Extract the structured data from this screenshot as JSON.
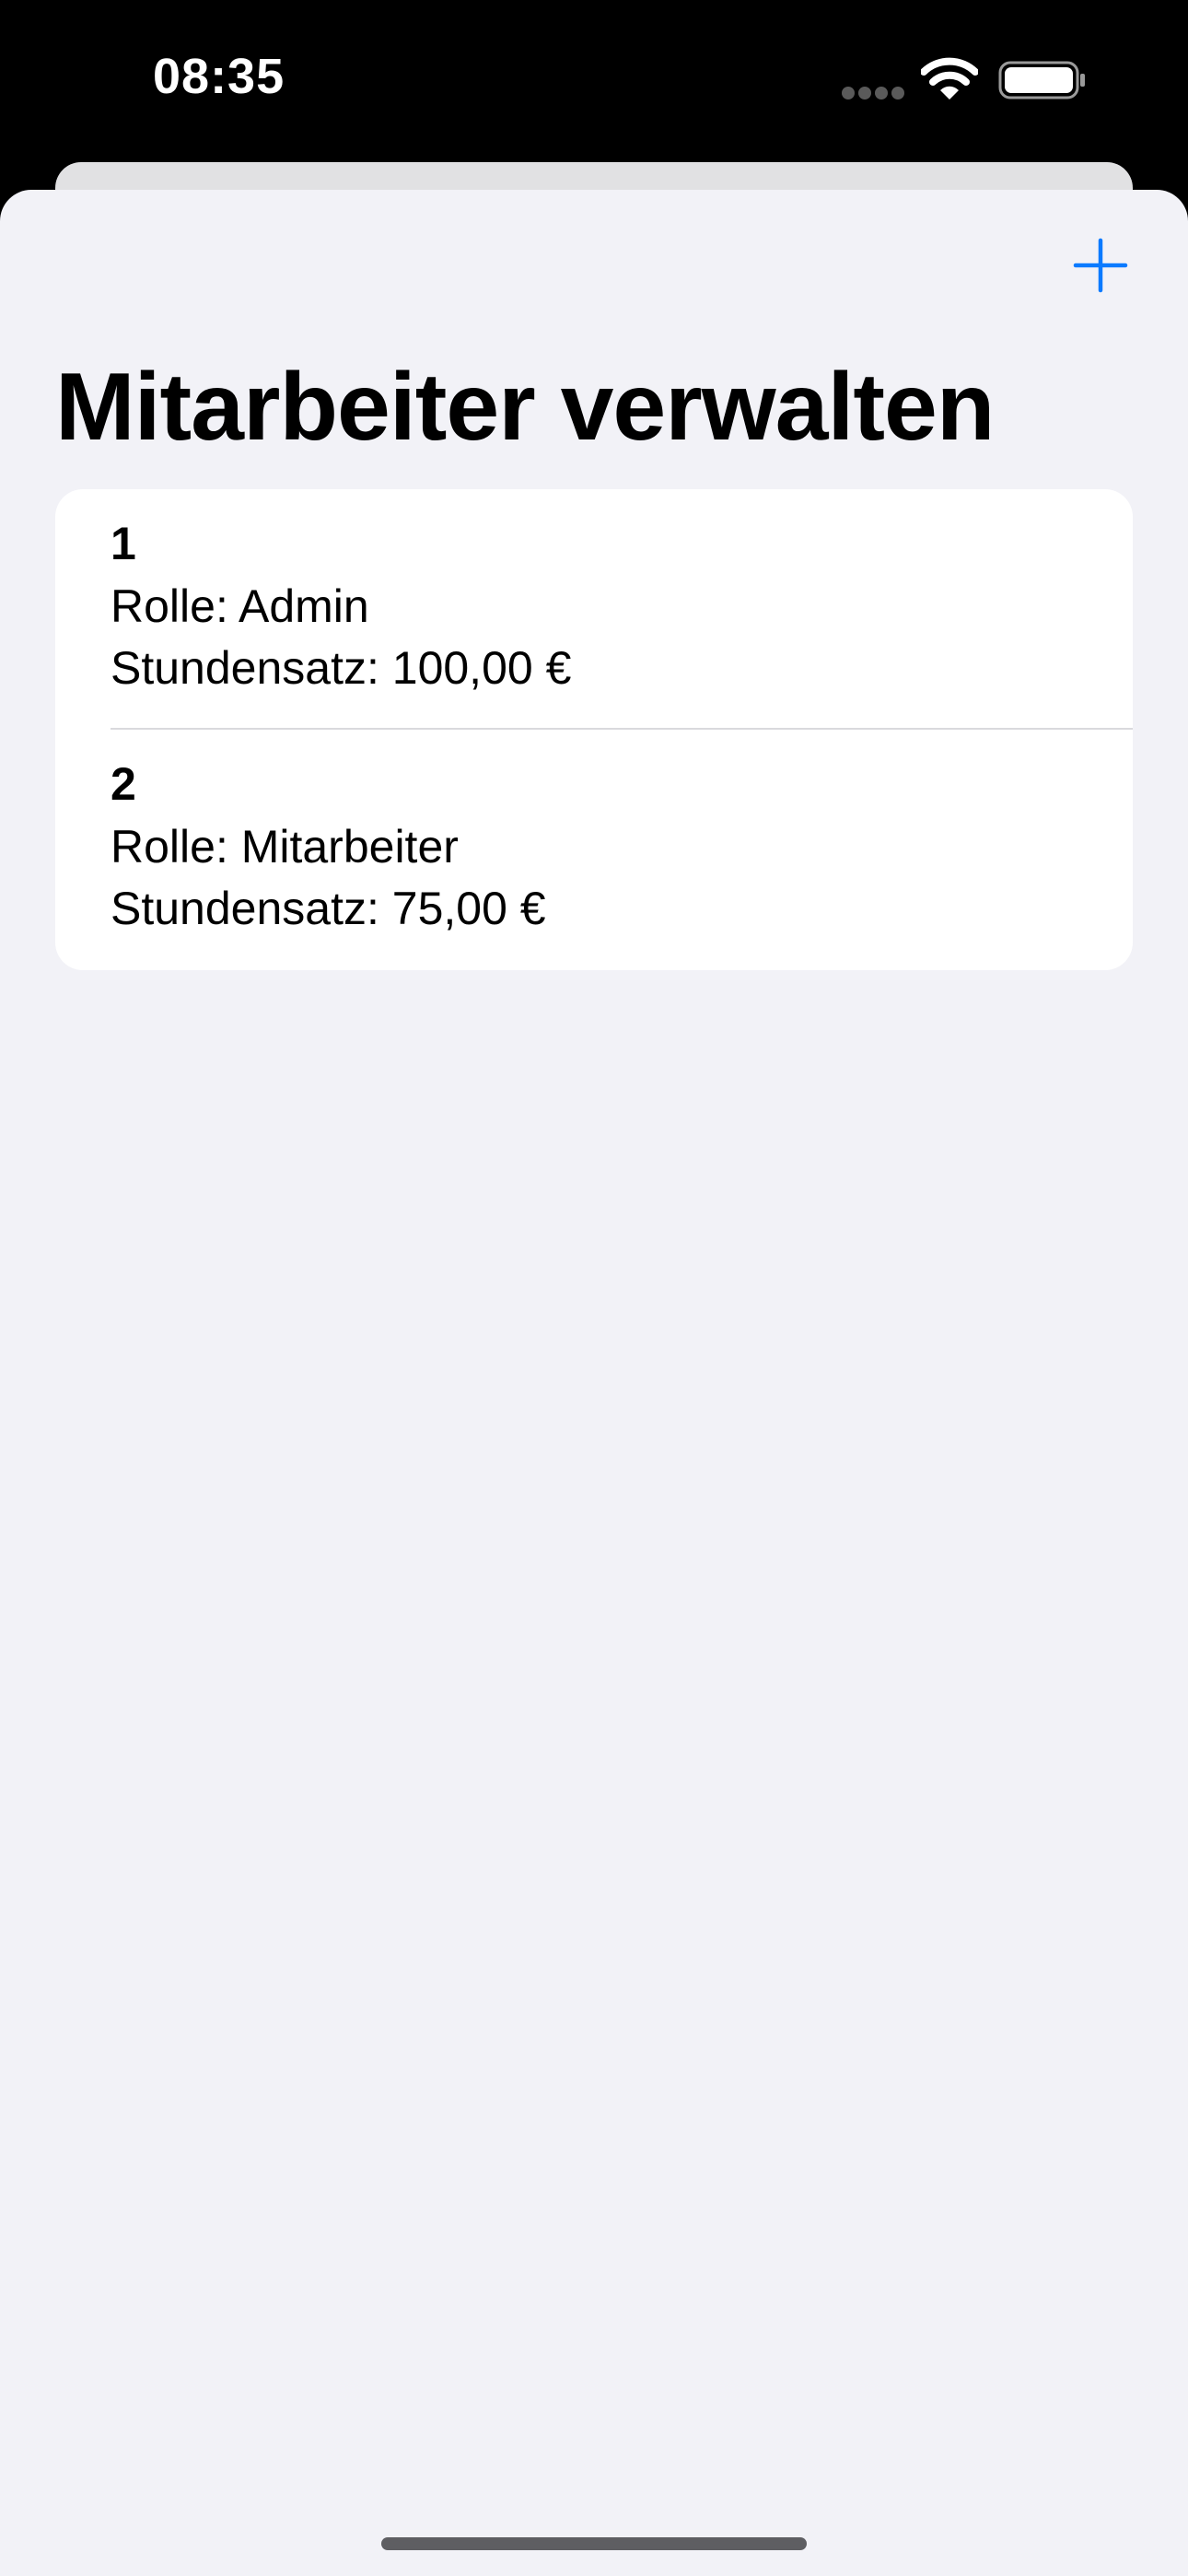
{
  "status_bar": {
    "time": "08:35"
  },
  "toolbar": {
    "add_icon": "plus-icon",
    "accent_color": "#0a7aff"
  },
  "page": {
    "title": "Mitarbeiter verwalten"
  },
  "employees": [
    {
      "id": "1",
      "role": "Rolle: Admin",
      "rate": "Stundensatz: 100,00 €"
    },
    {
      "id": "2",
      "role": "Rolle: Mitarbeiter",
      "rate": "Stundensatz: 75,00 €"
    }
  ]
}
